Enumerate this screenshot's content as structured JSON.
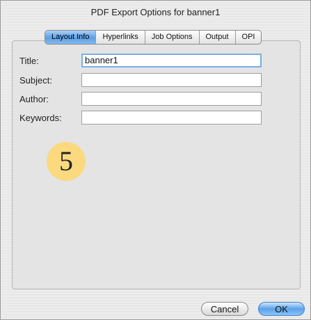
{
  "window": {
    "title": "PDF Export Options for banner1"
  },
  "tabs": [
    {
      "label": "Layout Info",
      "active": true
    },
    {
      "label": "Hyperlinks",
      "active": false
    },
    {
      "label": "Job Options",
      "active": false
    },
    {
      "label": "Output",
      "active": false
    },
    {
      "label": "OPI",
      "active": false
    }
  ],
  "form": {
    "title": {
      "label": "Title:",
      "value": "banner1"
    },
    "subject": {
      "label": "Subject:",
      "value": ""
    },
    "author": {
      "label": "Author:",
      "value": ""
    },
    "keywords": {
      "label": "Keywords:",
      "value": ""
    }
  },
  "step_badge": "5",
  "buttons": {
    "cancel": "Cancel",
    "ok": "OK"
  },
  "colors": {
    "accent": "#5b9fe6",
    "badge": "#fbd97e"
  }
}
